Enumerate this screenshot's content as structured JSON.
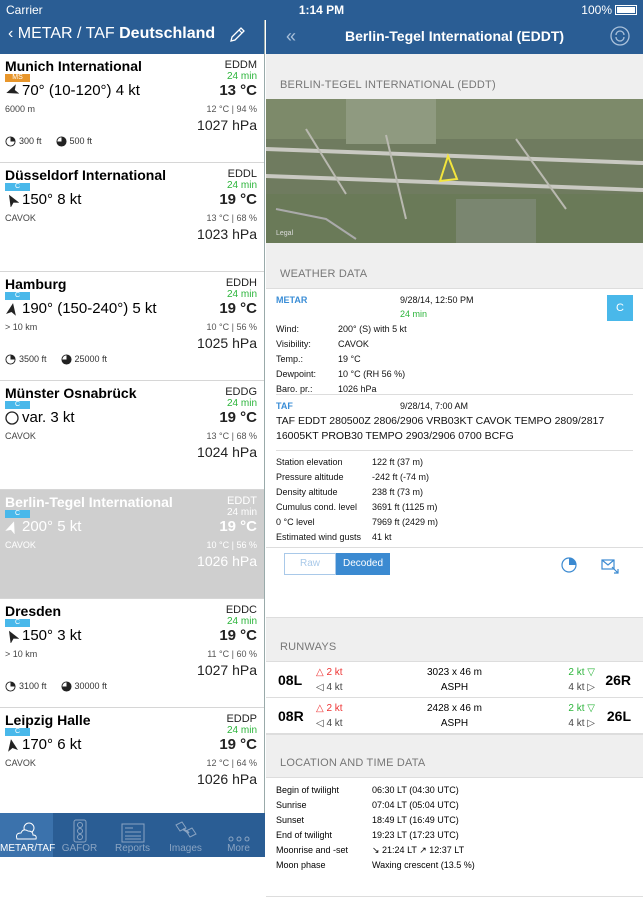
{
  "status": {
    "carrier": "Carrier",
    "time": "1:14 PM",
    "battery": "100%"
  },
  "left_nav": {
    "back_label": "METAR / TAF",
    "title": "Deutschland"
  },
  "stations": [
    {
      "name": "Munich International",
      "code": "EDDM",
      "badge": "MS",
      "badge_color": "#e8962b",
      "age": "24 min",
      "wind": "70° (10-120°) 4 kt",
      "wind_dir": 70,
      "temp": "13 °C",
      "vis": "6000 m",
      "hum": "12 °C | 94 %",
      "press": "1027 hPa",
      "clouds": [
        {
          "type": "sct",
          "label": "300 ft"
        },
        {
          "type": "bkn",
          "label": "500 ft"
        }
      ]
    },
    {
      "name": "Düsseldorf International",
      "code": "EDDL",
      "badge": "C",
      "badge_color": "#49b8ea",
      "age": "24 min",
      "wind": "150° 8 kt",
      "wind_dir": 150,
      "temp": "19 °C",
      "vis": "CAVOK",
      "hum": "13 °C | 68 %",
      "press": "1023 hPa",
      "clouds": []
    },
    {
      "name": "Hamburg",
      "code": "EDDH",
      "badge": "C",
      "badge_color": "#49b8ea",
      "age": "24 min",
      "wind": "190° (150-240°) 5 kt",
      "wind_dir": 190,
      "temp": "19 °C",
      "vis": "> 10 km",
      "hum": "10 °C | 56 %",
      "press": "1025 hPa",
      "clouds": [
        {
          "type": "sct",
          "label": "3500 ft"
        },
        {
          "type": "bkn",
          "label": "25000 ft"
        }
      ]
    },
    {
      "name": "Münster Osnabrück",
      "code": "EDDG",
      "badge": "C",
      "badge_color": "#49b8ea",
      "age": "24 min",
      "wind": "var. 3 kt",
      "wind_dir": -1,
      "temp": "19 °C",
      "vis": "CAVOK",
      "hum": "13 °C | 68 %",
      "press": "1024 hPa",
      "clouds": []
    },
    {
      "name": "Berlin-Tegel International",
      "code": "EDDT",
      "badge": "C",
      "badge_color": "#49b8ea",
      "age": "24 min",
      "wind": "200° 5 kt",
      "wind_dir": 200,
      "temp": "19 °C",
      "vis": "CAVOK",
      "hum": "10 °C | 56 %",
      "press": "1026 hPa",
      "clouds": [],
      "selected": true
    },
    {
      "name": "Dresden",
      "code": "EDDC",
      "badge": "C",
      "badge_color": "#49b8ea",
      "age": "24 min",
      "wind": "150° 3 kt",
      "wind_dir": 150,
      "temp": "19 °C",
      "vis": "> 10 km",
      "hum": "11 °C | 60 %",
      "press": "1027 hPa",
      "clouds": [
        {
          "type": "sct",
          "label": "3100 ft"
        },
        {
          "type": "bkn",
          "label": "30000 ft"
        }
      ]
    },
    {
      "name": "Leipzig Halle",
      "code": "EDDP",
      "badge": "C",
      "badge_color": "#49b8ea",
      "age": "24 min",
      "wind": "170° 6 kt",
      "wind_dir": 170,
      "temp": "19 °C",
      "vis": "CAVOK",
      "hum": "12 °C | 64 %",
      "press": "1026 hPa",
      "clouds": []
    }
  ],
  "tabs": [
    {
      "label": "METAR/TAF",
      "icon": "cloud-sun-icon",
      "active": true
    },
    {
      "label": "GAFOR",
      "icon": "traffic-light-icon",
      "active": false
    },
    {
      "label": "Reports",
      "icon": "newspaper-icon",
      "active": false
    },
    {
      "label": "Images",
      "icon": "satellite-icon",
      "active": false
    },
    {
      "label": "More",
      "icon": "more-dots-icon",
      "active": false
    }
  ],
  "detail": {
    "title": "Berlin-Tegel International (EDDT)",
    "map_header": "BERLIN-TEGEL INTERNATIONAL (EDDT)",
    "map_legal": "Legal",
    "weather_header": "WEATHER DATA",
    "metar": {
      "label": "METAR",
      "date": "9/28/14, 12:50 PM",
      "age": "24 min",
      "badge": "C",
      "rows": [
        [
          "Wind:",
          "200° (S) with 5 kt"
        ],
        [
          "Visibility:",
          "CAVOK"
        ],
        [
          "Temp.:",
          "19 °C"
        ],
        [
          "Dewpoint:",
          "10 °C (RH 56 %)"
        ],
        [
          "Baro. pr.:",
          "1026 hPa"
        ]
      ]
    },
    "taf": {
      "label": "TAF",
      "date": "9/28/14, 7:00 AM",
      "text": "TAF EDDT 280500Z 2806/2906 VRB03KT CAVOK TEMPO 2809/2817 16005KT PROB30 TEMPO 2903/2906 0700 BCFG"
    },
    "derived": [
      [
        "Station elevation",
        "122 ft (37 m)"
      ],
      [
        "Pressure altitude",
        "-242 ft (-74 m)"
      ],
      [
        "Density altitude",
        "238 ft (73 m)"
      ],
      [
        "Cumulus cond. level",
        "3691 ft (1125 m)"
      ],
      [
        "0 °C level",
        "7969 ft (2429 m)"
      ],
      [
        "Estimated wind gusts",
        "41 kt"
      ]
    ],
    "toggle": {
      "raw": "Raw",
      "decoded": "Decoded"
    },
    "runways_header": "RUNWAYS",
    "runways": [
      {
        "left": "08L",
        "right": "26R",
        "dim": "3023 x 46 m",
        "surface": "ASPH",
        "lh": "△ 2 kt",
        "lx": "◁ 4 kt",
        "rh": "2 kt ▽",
        "rx": "4 kt ▷"
      },
      {
        "left": "08R",
        "right": "26L",
        "dim": "2428 x 46 m",
        "surface": "ASPH",
        "lh": "△ 2 kt",
        "lx": "◁ 4 kt",
        "rh": "2 kt ▽",
        "rx": "4 kt ▷"
      }
    ],
    "location_header": "LOCATION AND TIME DATA",
    "times": [
      [
        "Begin of twilight",
        "06:30 LT (04:30 UTC)"
      ],
      [
        "Sunrise",
        "07:04 LT (05:04 UTC)"
      ],
      [
        "Sunset",
        "18:49 LT (16:49 UTC)"
      ],
      [
        "End of twilight",
        "19:23 LT (17:23 UTC)"
      ],
      [
        "Moonrise and -set",
        "↘ 21:24 LT ↗ 12:37 LT"
      ],
      [
        "Moon phase",
        "Waxing crescent (13.5 %)"
      ]
    ]
  }
}
